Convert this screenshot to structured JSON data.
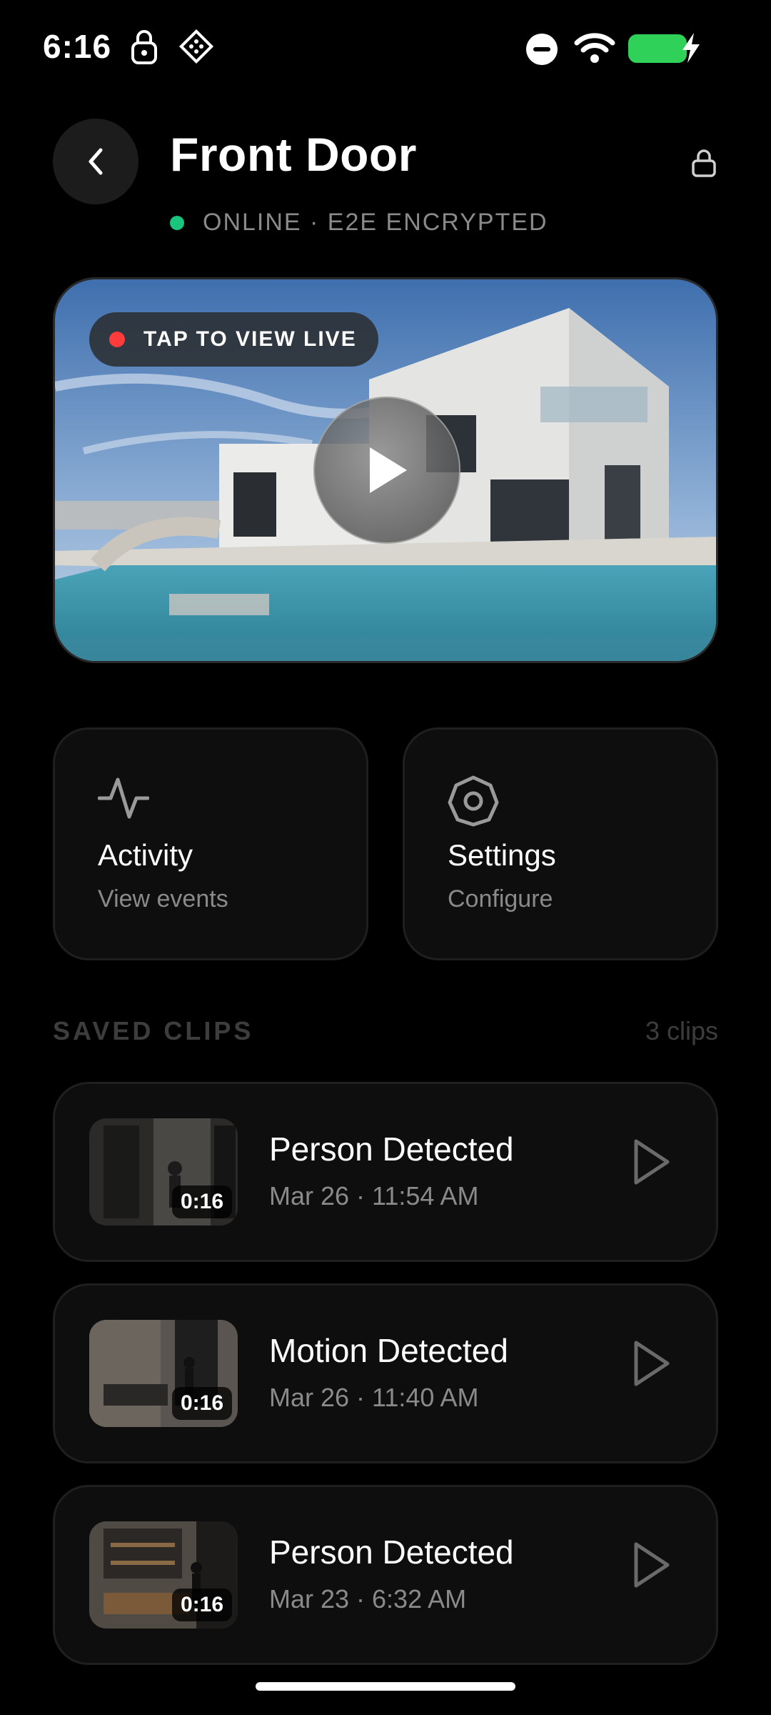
{
  "status_bar": {
    "time": "6:16",
    "icons": [
      "lock-icon",
      "app-icon",
      "do-not-disturb-icon",
      "wifi-icon",
      "battery-charging-icon"
    ],
    "battery_color": "#2fd158"
  },
  "header": {
    "title": "Front Door",
    "back_icon": "chevron-left-icon",
    "lock_icon": "lock-icon",
    "status_text": "ONLINE · E2E ENCRYPTED",
    "status_color": "#1bc47d"
  },
  "live": {
    "pill_label": "TAP TO VIEW LIVE",
    "rec_color": "#ff3b3b",
    "play_icon": "play-icon"
  },
  "tiles": [
    {
      "title": "Activity",
      "subtitle": "View events",
      "icon": "activity-icon"
    },
    {
      "title": "Settings",
      "subtitle": "Configure",
      "icon": "gear-icon"
    }
  ],
  "clips_section": {
    "label": "SAVED CLIPS",
    "count": "3 clips"
  },
  "clips": [
    {
      "title": "Person Detected",
      "time": "Mar 26 · 11:54 AM",
      "duration": "0:16"
    },
    {
      "title": "Motion Detected",
      "time": "Mar 26 · 11:40 AM",
      "duration": "0:16"
    },
    {
      "title": "Person Detected",
      "time": "Mar 23 · 6:32 AM",
      "duration": "0:16"
    }
  ],
  "colors": {
    "background": "#000000",
    "card": "#0e0e0e",
    "muted_text": "#8a8a8a"
  }
}
